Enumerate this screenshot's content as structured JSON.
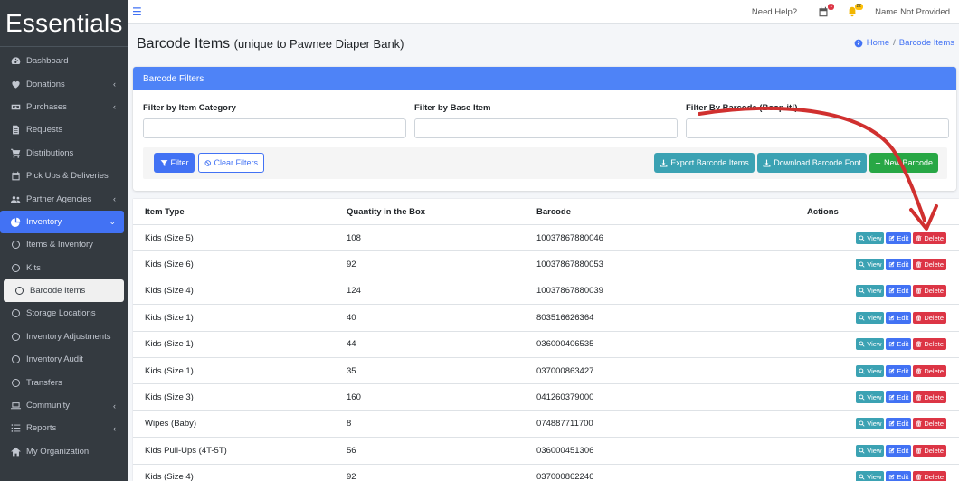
{
  "sidebar": {
    "brand": "Essentials",
    "items": [
      {
        "label": "Dashboard",
        "icon": "dashboard-icon",
        "chevron": ""
      },
      {
        "label": "Donations",
        "icon": "donations-icon",
        "chevron": "‹"
      },
      {
        "label": "Purchases",
        "icon": "money-icon",
        "chevron": "‹"
      },
      {
        "label": "Requests",
        "icon": "file-icon",
        "chevron": ""
      },
      {
        "label": "Distributions",
        "icon": "cart-icon",
        "chevron": ""
      },
      {
        "label": "Pick Ups & Deliveries",
        "icon": "calendar-icon",
        "chevron": ""
      },
      {
        "label": "Partner Agencies",
        "icon": "users-icon",
        "chevron": "‹"
      },
      {
        "label": "Inventory",
        "icon": "pie-chart-icon",
        "chevron": "⌄"
      },
      {
        "label": "Items & Inventory"
      },
      {
        "label": "Kits"
      },
      {
        "label": "Barcode Items"
      },
      {
        "label": "Storage Locations"
      },
      {
        "label": "Inventory Adjustments"
      },
      {
        "label": "Inventory Audit"
      },
      {
        "label": "Transfers"
      },
      {
        "label": "Community",
        "icon": "laptop-icon",
        "chevron": "‹"
      },
      {
        "label": "Reports",
        "icon": "list-icon",
        "chevron": "‹"
      },
      {
        "label": "My Organization",
        "icon": "home-icon",
        "chevron": ""
      }
    ]
  },
  "topbar": {
    "help": "Need Help?",
    "notif_badge": "1",
    "alert_badge": "22",
    "user": "Name Not Provided"
  },
  "header": {
    "title": "Barcode Items",
    "subtitle": "(unique to Pawnee Diaper Bank)",
    "breadcrumb_home": "Home",
    "breadcrumb_sep": "/",
    "breadcrumb_current": "Barcode Items"
  },
  "filters": {
    "title": "Barcode Filters",
    "category_label": "Filter by Item Category",
    "base_item_label": "Filter by Base Item",
    "barcode_label": "Filter By Barcode (Boop it!)",
    "filter_btn": "Filter",
    "clear_btn": "Clear Filters",
    "export_btn": "Export Barcode Items",
    "download_font_btn": "Download Barcode Font",
    "new_btn": "New Barcode"
  },
  "table": {
    "headers": [
      "Item Type",
      "Quantity in the Box",
      "Barcode",
      "Actions"
    ],
    "view_label": "View",
    "edit_label": "Edit",
    "delete_label": "Delete",
    "rows": [
      {
        "item": "Kids (Size 5)",
        "qty": "108",
        "barcode": "10037867880046"
      },
      {
        "item": "Kids (Size 6)",
        "qty": "92",
        "barcode": "10037867880053"
      },
      {
        "item": "Kids (Size 4)",
        "qty": "124",
        "barcode": "10037867880039"
      },
      {
        "item": "Kids (Size 1)",
        "qty": "40",
        "barcode": "803516626364"
      },
      {
        "item": "Kids (Size 1)",
        "qty": "44",
        "barcode": "036000406535"
      },
      {
        "item": "Kids (Size 1)",
        "qty": "35",
        "barcode": "037000863427"
      },
      {
        "item": "Kids (Size 3)",
        "qty": "160",
        "barcode": "041260379000"
      },
      {
        "item": "Wipes (Baby)",
        "qty": "8",
        "barcode": "074887711700"
      },
      {
        "item": "Kids Pull-Ups (4T-5T)",
        "qty": "56",
        "barcode": "036000451306"
      },
      {
        "item": "Kids (Size 4)",
        "qty": "92",
        "barcode": "037000862246"
      }
    ]
  },
  "colors": {
    "accent": "#4272f4",
    "sidebar_bg": "#343a40",
    "info": "#3ba2b3",
    "success": "#28a745",
    "danger": "#dc3545",
    "annotation_arrow": "#d0302f"
  }
}
